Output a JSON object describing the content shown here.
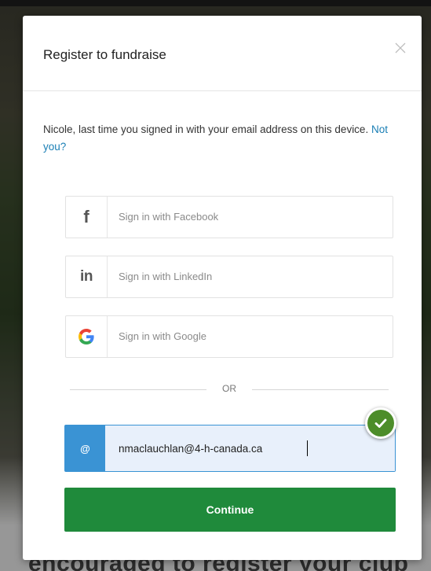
{
  "background": {
    "bottom_text": "encouraged to register your club"
  },
  "modal": {
    "title": "Register to fundraise",
    "close_symbol": "✕",
    "notice_text": "Nicole, last time you signed in with your email address on this device.",
    "notice_link": "Not you?"
  },
  "social": [
    {
      "label": "Sign in with Facebook",
      "icon": "facebook-icon",
      "glyph": "f"
    },
    {
      "label": "Sign in with LinkedIn",
      "icon": "linkedin-icon",
      "glyph": "in"
    },
    {
      "label": "Sign in with Google",
      "icon": "google-icon",
      "glyph": "G"
    }
  ],
  "divider": {
    "text": "OR"
  },
  "email": {
    "at_symbol": "@",
    "value": "nmaclauchlan@4-h-canada.ca"
  },
  "continue_button": {
    "label": "Continue"
  },
  "colors": {
    "primary_green": "#1f8a3b",
    "email_blue": "#3a93d4",
    "link_blue": "#1a7fb5",
    "check_green": "#4d8d2a"
  }
}
